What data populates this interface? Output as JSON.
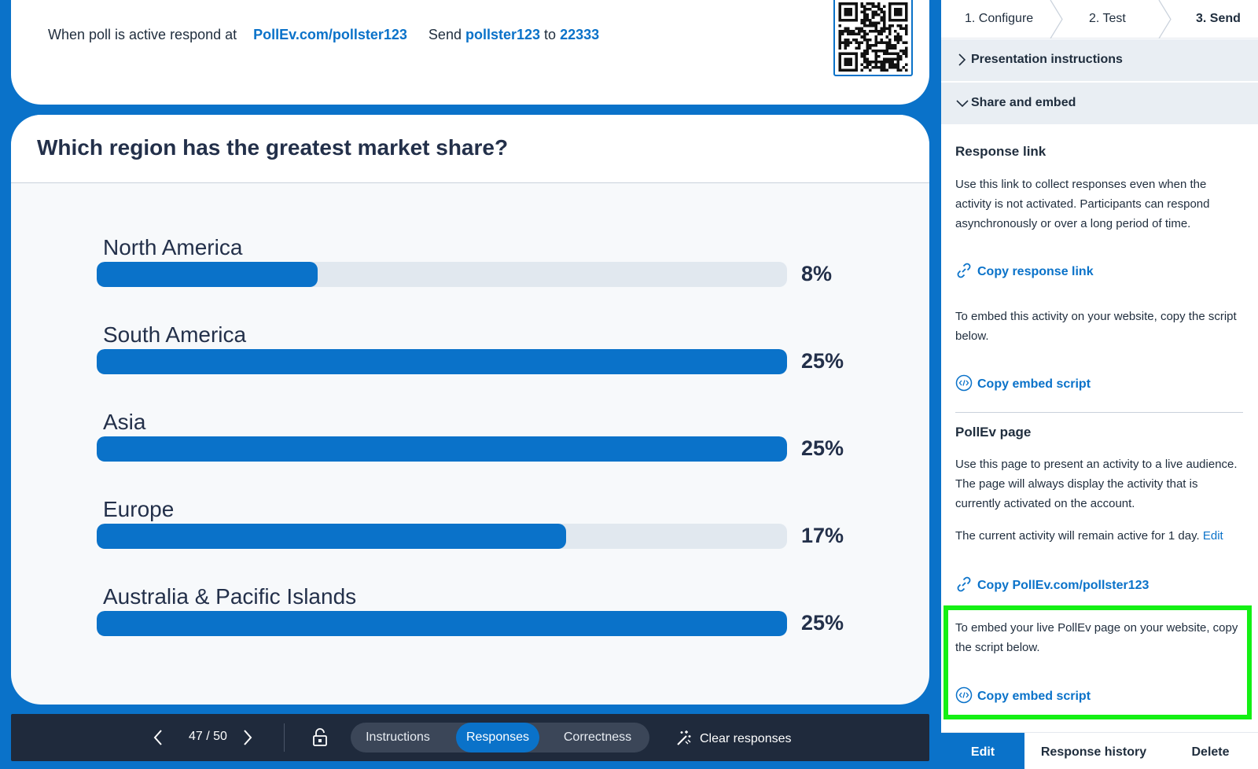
{
  "join": {
    "prefix": "When poll is active respond at",
    "url": "PollEv.com/pollster123",
    "send_word": "Send",
    "keyword": "pollster123",
    "to_word": "to",
    "number": "22333"
  },
  "question": {
    "title": "Which region has the greatest market share?"
  },
  "chart_data": {
    "type": "bar",
    "categories": [
      "North America",
      "South America",
      "Asia",
      "Europe",
      "Australia & Pacific Islands"
    ],
    "values": [
      8,
      25,
      25,
      17,
      25
    ],
    "value_labels": [
      "8%",
      "25%",
      "25%",
      "17%",
      "25%"
    ],
    "max": 25
  },
  "toolbar": {
    "prev_icon": "chevron-left-icon",
    "next_icon": "chevron-right-icon",
    "page_counter": "47 / 50",
    "lock_icon": "lock-icon",
    "tabs": [
      "Instructions",
      "Responses",
      "Correctness"
    ],
    "active_tab": "Responses",
    "clear_label": "Clear responses"
  },
  "sidebar": {
    "steps": [
      "1. Configure",
      "2. Test",
      "3. Send"
    ],
    "current_step": "3. Send",
    "presentation_instructions": "Presentation instructions",
    "share_and_embed": "Share and embed",
    "response_link": {
      "heading": "Response link",
      "text": "Use this link to collect responses even when the activity is not activated. Participants can respond asynchronously or over a long period of time.",
      "copy_link": "Copy response link",
      "embed_text": "To embed this activity on your website, copy the script below.",
      "copy_embed": "Copy embed script"
    },
    "pollev_page": {
      "heading": "PollEv page",
      "text": "Use this page to present an activity to a live audience. The page will always display the activity that is currently activated on the account.",
      "active_text": "The current activity will remain active for 1 day.",
      "edit_link": "Edit",
      "copy_link": "Copy PollEv.com/pollster123",
      "embed_text": "To embed your live PollEv page on your website, copy the script below.",
      "copy_embed": "Copy embed script"
    },
    "bottom": {
      "edit": "Edit",
      "history": "Response history",
      "delete": "Delete"
    },
    "highlight_color": "#14f014"
  },
  "colors": {
    "brand_blue": "#0a72c9",
    "toolbar_bg": "#1f2a3c",
    "track": "#e1e8ef"
  }
}
